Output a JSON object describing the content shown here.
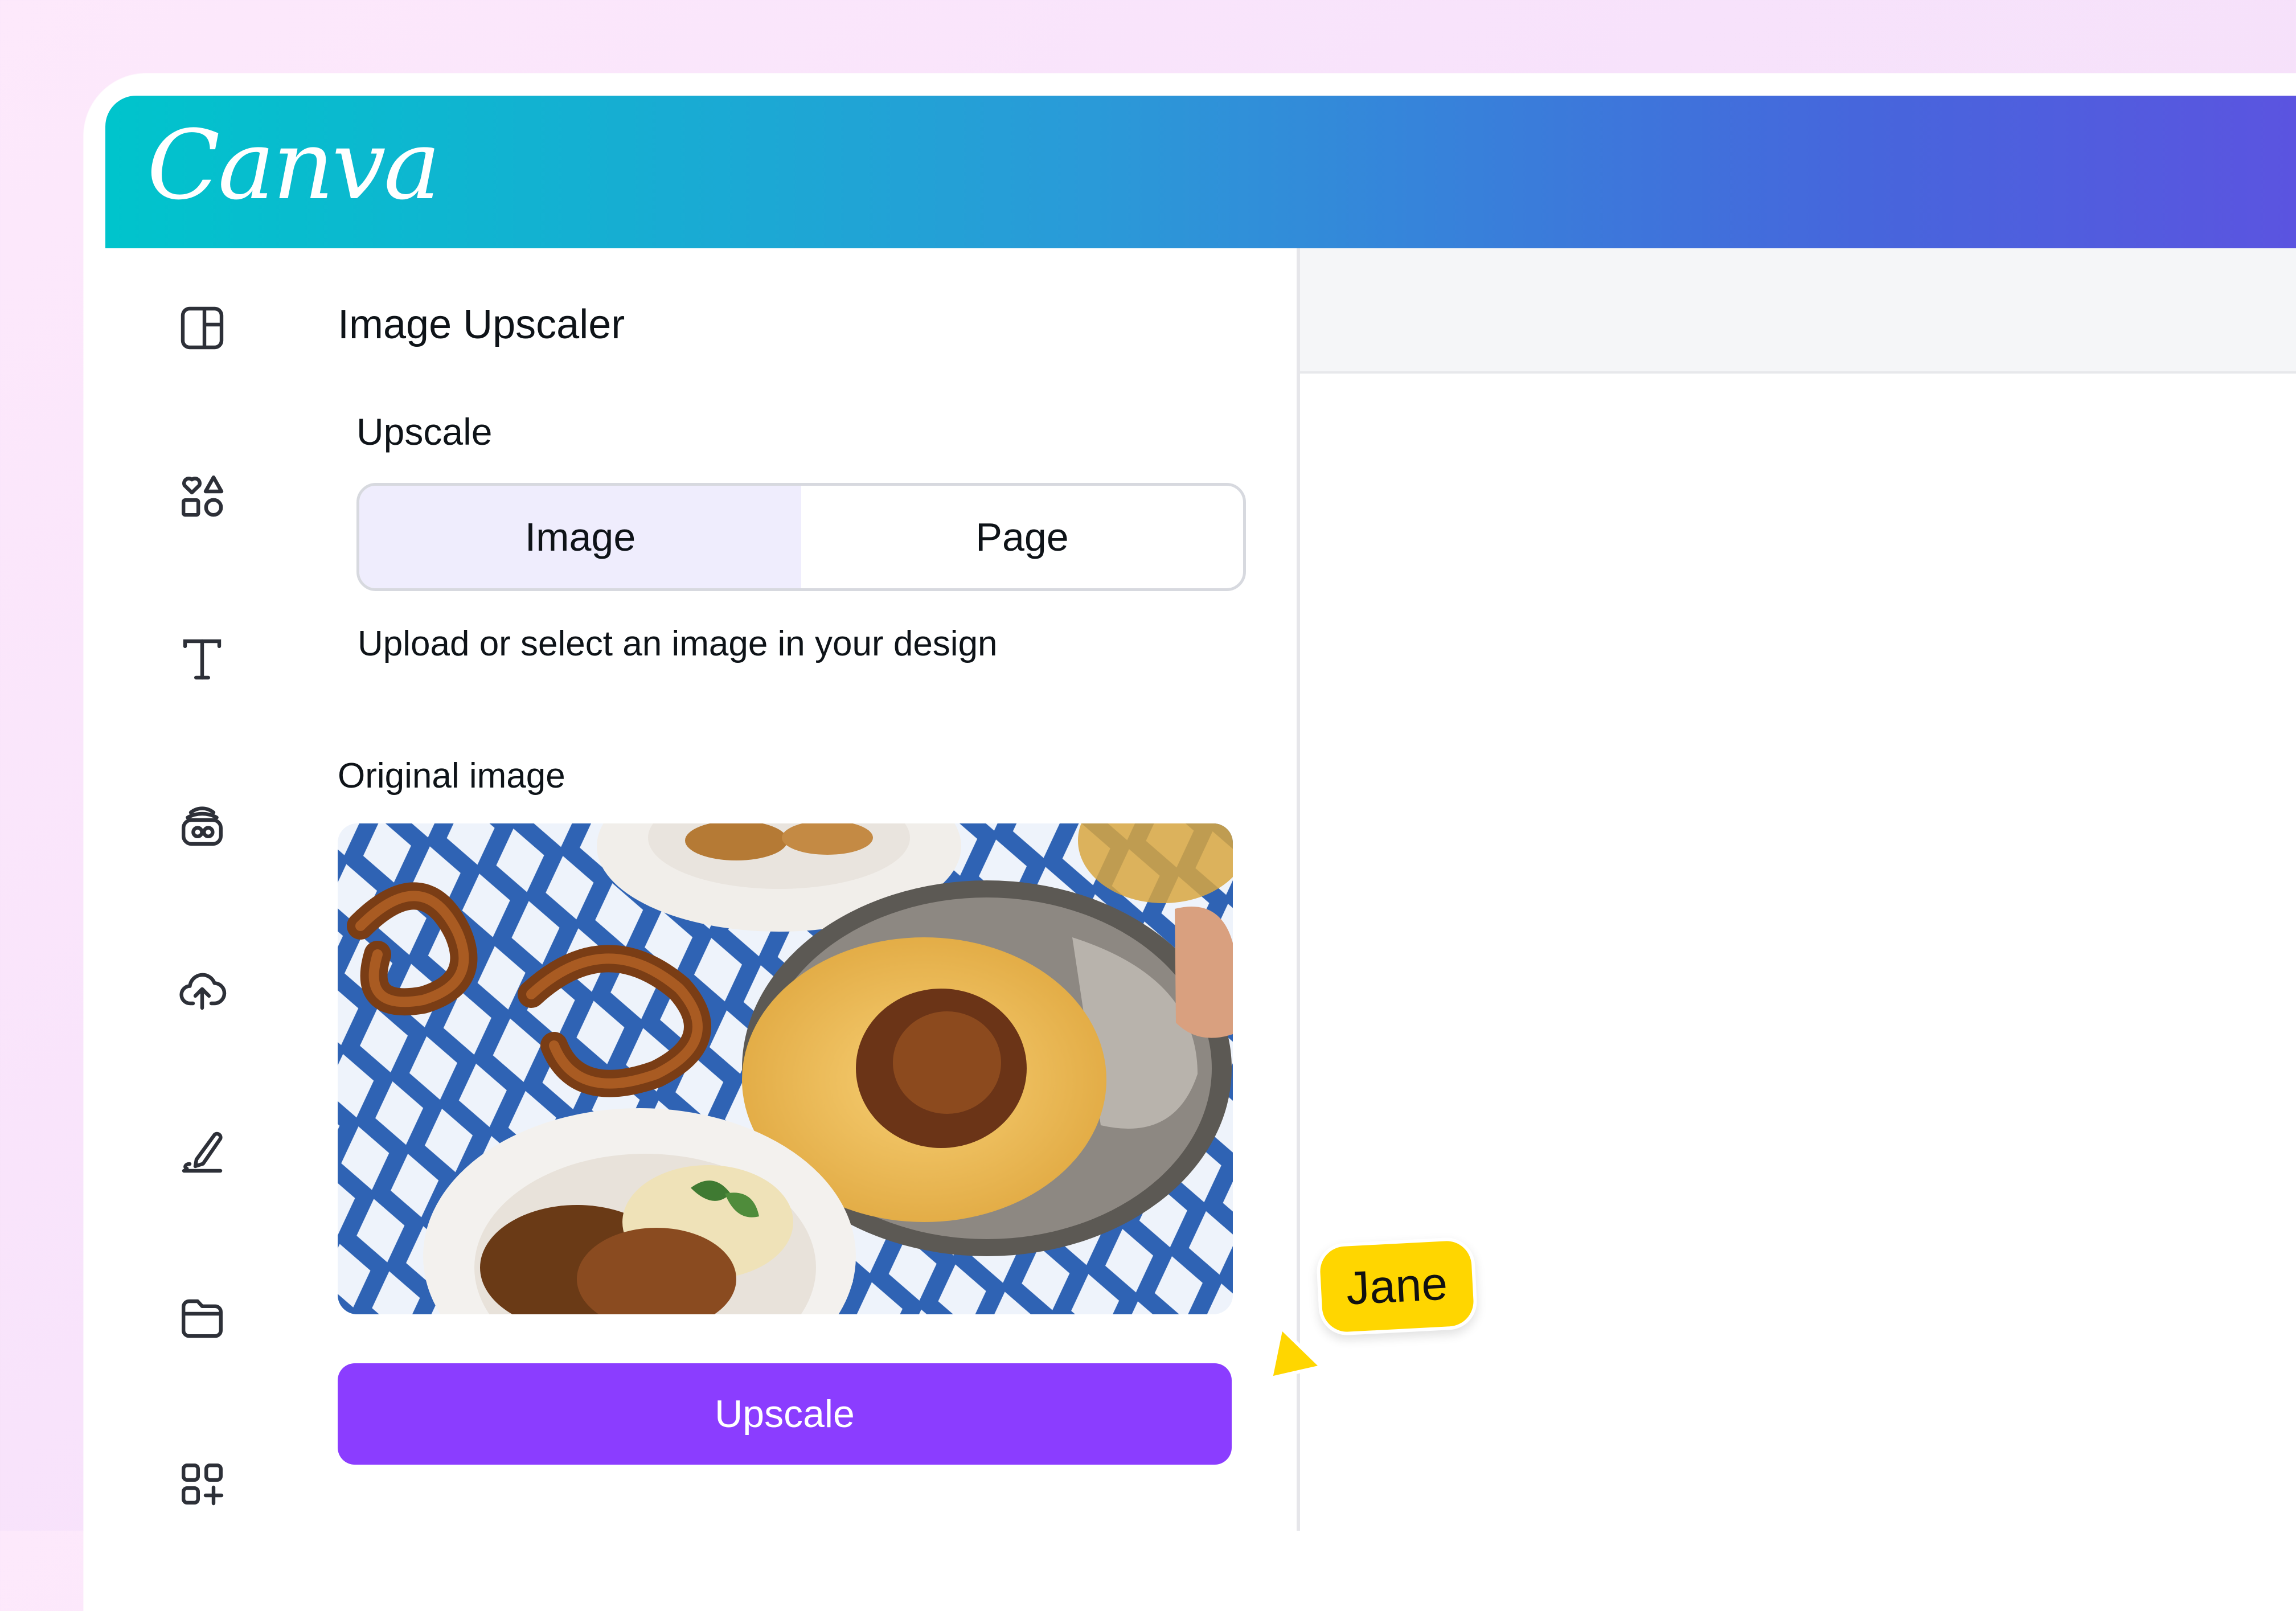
{
  "app": {
    "logo_text": "Canva"
  },
  "sidebar": {
    "items": [
      {
        "icon": "design-layout-icon"
      },
      {
        "icon": "elements-shapes-icon"
      },
      {
        "icon": "text-icon"
      },
      {
        "icon": "brand-hub-icon"
      },
      {
        "icon": "uploads-cloud-icon"
      },
      {
        "icon": "draw-pen-icon"
      },
      {
        "icon": "projects-folder-icon"
      },
      {
        "icon": "apps-grid-plus-icon"
      }
    ]
  },
  "panel": {
    "title": "Image Upscaler",
    "upscale_label": "Upscale",
    "segments": [
      {
        "label": "Image",
        "selected": true
      },
      {
        "label": "Page",
        "selected": false
      }
    ],
    "helper_text": "Upload or select an image in your design",
    "original_image_label": "Original image",
    "primary_button_label": "Upscale"
  },
  "collaborator": {
    "name": "Jane",
    "color": "#ffd600"
  },
  "colors": {
    "accent_purple": "#8b3dff",
    "header_gradient_start": "#00c4cc",
    "header_gradient_end": "#5b54e0",
    "segment_selected_bg": "#efedfd"
  }
}
